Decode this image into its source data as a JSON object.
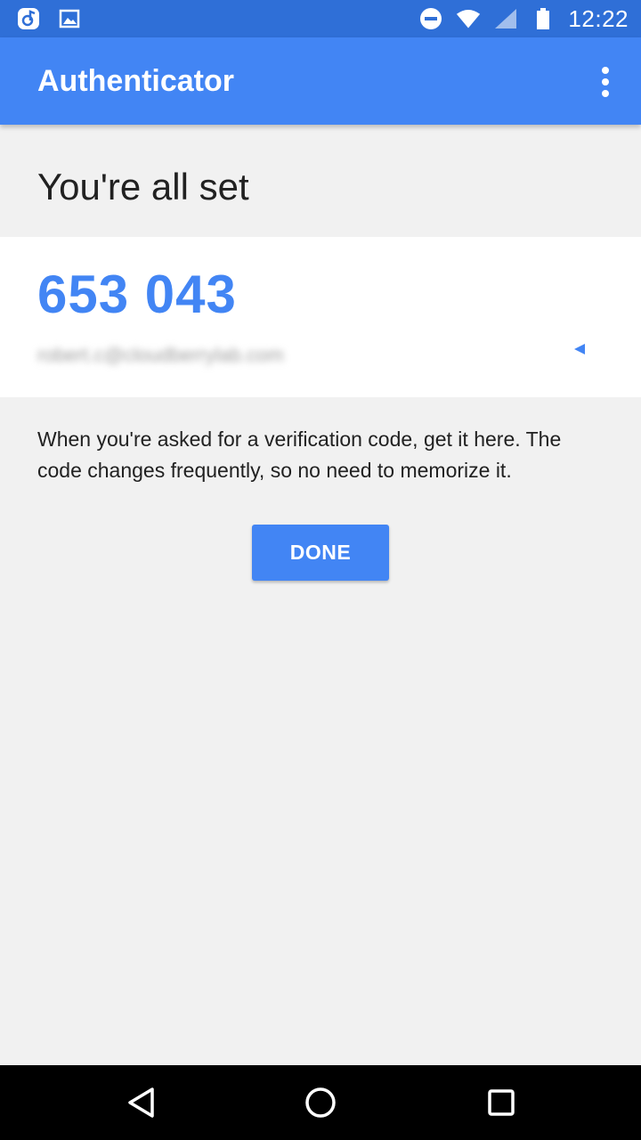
{
  "status_bar": {
    "time": "12:22",
    "notification_icons": [
      "music-app-icon",
      "image-icon"
    ],
    "system_icons": [
      "do-not-disturb-icon",
      "wifi-icon",
      "cell-signal-icon",
      "battery-icon"
    ]
  },
  "app_bar": {
    "title": "Authenticator",
    "menu_icon": "overflow-menu-icon"
  },
  "main": {
    "heading": "You're all set",
    "code": "653 043",
    "account": "robert.c@cloudberrylab.com",
    "description": "When you're asked for a verification code, get it here. The code changes frequently, so no need to memorize it.",
    "done_label": "DONE"
  },
  "nav_bar": {
    "buttons": [
      "back-icon",
      "home-icon",
      "recents-icon"
    ]
  },
  "colors": {
    "status_bar": "#2f6fd7",
    "app_bar": "#4285f4",
    "accent": "#4285f4",
    "background": "#f1f1f1"
  }
}
